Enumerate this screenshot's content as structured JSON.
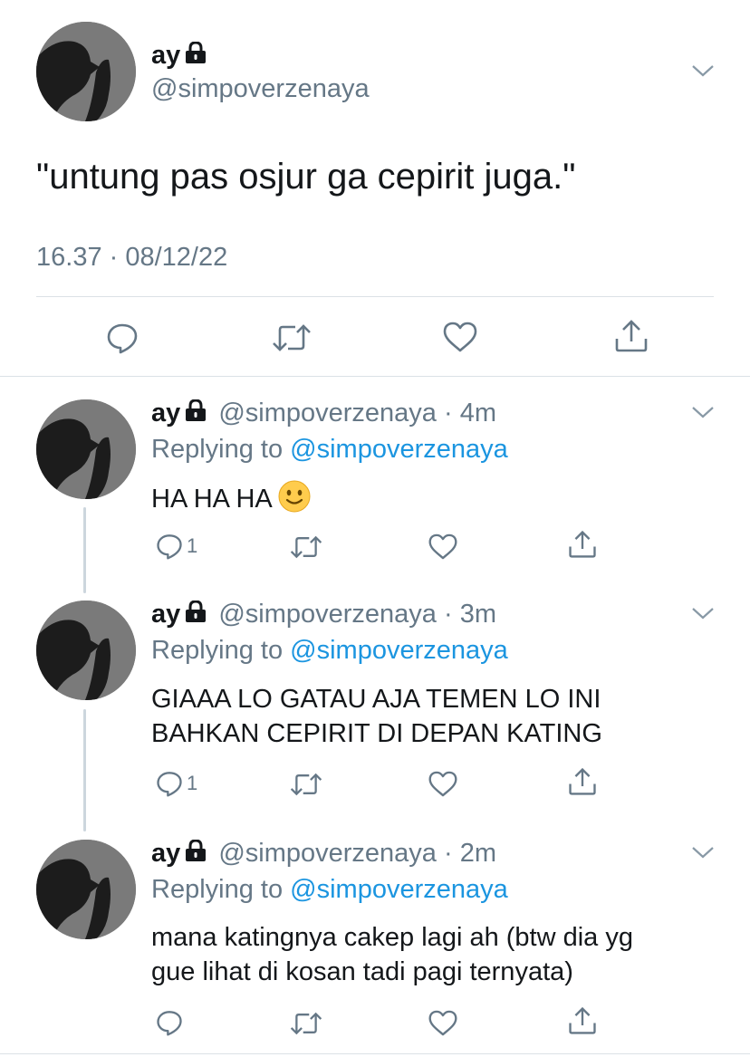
{
  "main_tweet": {
    "name": "ay",
    "handle": "@simpoverzenaya",
    "text": "\"untung pas osjur ga cepirit juga.\"",
    "timestamp": "16.37 · 08/12/22",
    "icons": [
      "reply-icon",
      "retweet-icon",
      "like-icon",
      "share-icon"
    ]
  },
  "replies": [
    {
      "name": "ay",
      "handle": "@simpoverzenaya",
      "time": "4m",
      "replying_label": "Replying to",
      "replying_handle": "@simpoverzenaya",
      "text": "HA HA HA",
      "emoji": "slightly-smiling-face",
      "reply_count": "1"
    },
    {
      "name": "ay",
      "handle": "@simpoverzenaya",
      "time": "3m",
      "replying_label": "Replying to",
      "replying_handle": "@simpoverzenaya",
      "text_lines": [
        "GIAAA LO GATAU AJA TEMEN LO INI",
        "BAHKAN CEPIRIT DI DEPAN KATING"
      ],
      "reply_count": "1"
    },
    {
      "name": "ay",
      "handle": "@simpoverzenaya",
      "time": "2m",
      "replying_label": "Replying to",
      "replying_handle": "@simpoverzenaya",
      "text_lines": [
        "mana katingnya cakep lagi ah (btw dia yg",
        "gue lihat di kosan tadi pagi ternyata)"
      ]
    }
  ],
  "colors": {
    "text": "#14171a",
    "muted": "#657786",
    "link": "#1b95e0",
    "divider": "#dbe1e6",
    "thread_line": "#ccd6dd"
  }
}
